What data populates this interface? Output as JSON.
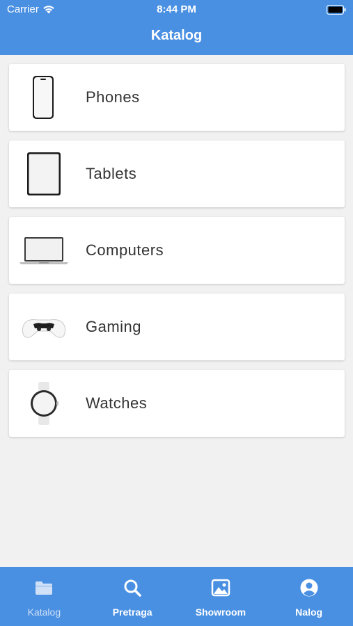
{
  "status_bar": {
    "carrier": "Carrier",
    "time": "8:44 PM"
  },
  "nav": {
    "title": "Katalog"
  },
  "categories": [
    {
      "label": "Phones",
      "icon": "phone-icon"
    },
    {
      "label": "Tablets",
      "icon": "tablet-icon"
    },
    {
      "label": "Computers",
      "icon": "laptop-icon"
    },
    {
      "label": "Gaming",
      "icon": "gamepad-icon"
    },
    {
      "label": "Watches",
      "icon": "watch-icon"
    }
  ],
  "tabbar": {
    "items": [
      {
        "label": "Katalog",
        "icon": "folder-icon",
        "active": true
      },
      {
        "label": "Pretraga",
        "icon": "search-icon",
        "active": false
      },
      {
        "label": "Showroom",
        "icon": "image-icon",
        "active": false
      },
      {
        "label": "Nalog",
        "icon": "user-icon",
        "active": false
      }
    ]
  },
  "colors": {
    "accent": "#4a90e2",
    "background": "#f1f1f1",
    "card": "#ffffff",
    "text": "#333333"
  }
}
